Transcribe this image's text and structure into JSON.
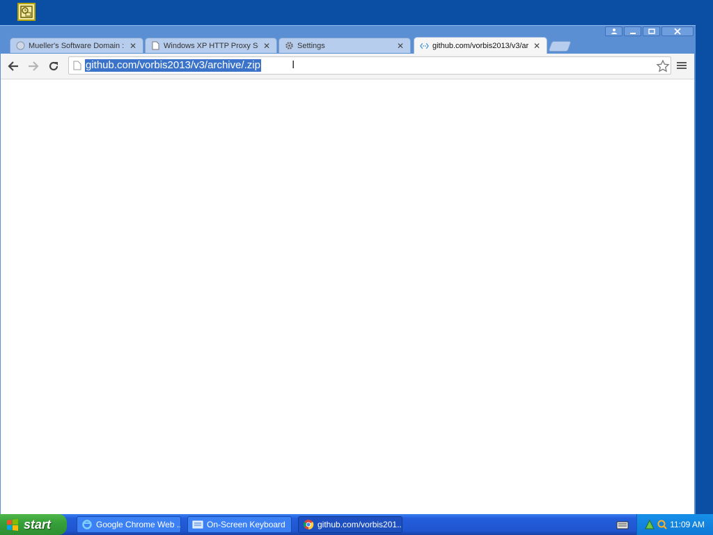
{
  "browser": {
    "tabs": [
      {
        "title": "Mueller's Software Domain ::",
        "icon": "globe-icon",
        "active": false
      },
      {
        "title": "Windows XP HTTP Proxy Set",
        "icon": "page-icon",
        "active": false
      },
      {
        "title": "Settings",
        "icon": "gear-icon",
        "active": false
      },
      {
        "title": "github.com/vorbis2013/v3/ar",
        "icon": "loading-icon",
        "active": true
      }
    ],
    "omnibox": {
      "url": "github.com/vorbis2013/v3/archive/.zip"
    }
  },
  "taskbar": {
    "start_label": "start",
    "tasks": [
      {
        "label": "Google Chrome Web ...",
        "icon": "ie-icon"
      },
      {
        "label": "On-Screen Keyboard",
        "icon": "keyboard-icon"
      },
      {
        "label": "github.com/vorbis201...",
        "icon": "chrome-icon",
        "active": true
      }
    ],
    "clock": "11:09 AM"
  },
  "colors": {
    "desktop": "#0a4fa3",
    "selection": "#3a73c9",
    "taskbar": "#245edb",
    "start_green": "#36a13a"
  }
}
